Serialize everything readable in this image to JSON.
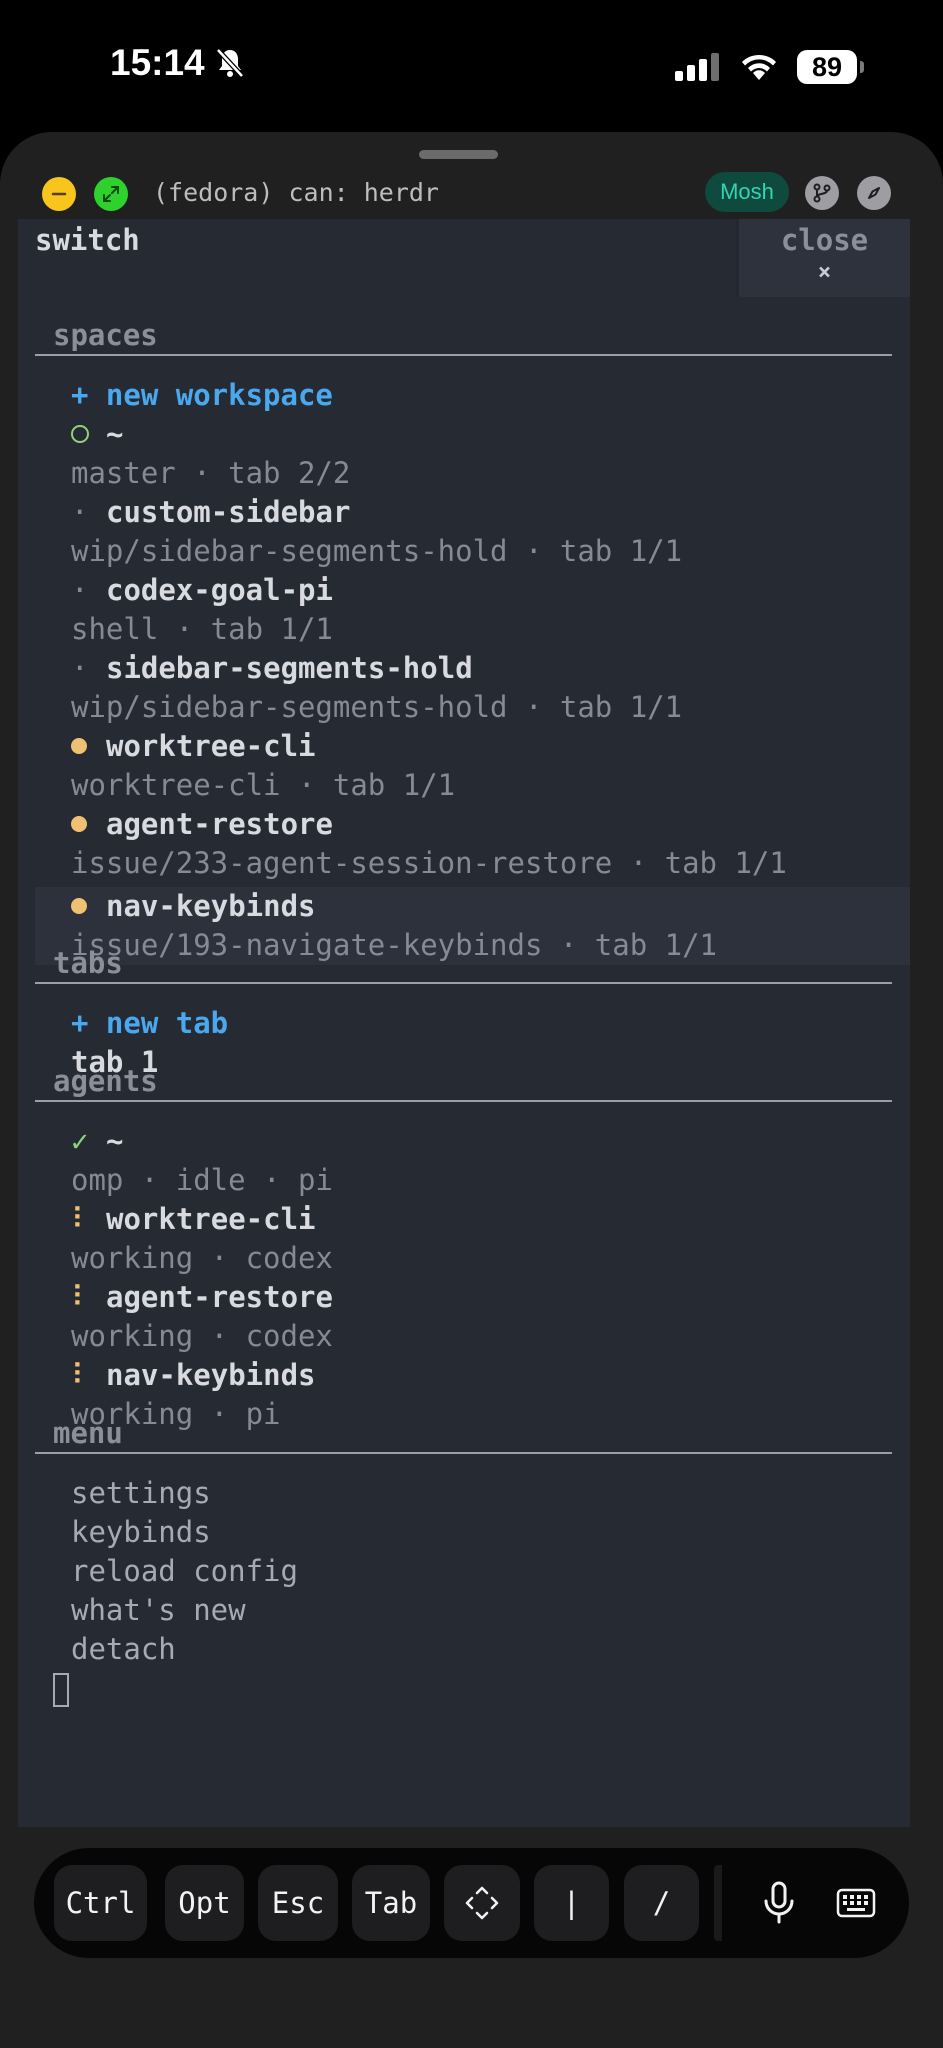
{
  "status_bar": {
    "time": "15:14",
    "battery": "89"
  },
  "header": {
    "title": "(fedora) can: herdr",
    "badge": "Mosh"
  },
  "terminal": {
    "title": "switch",
    "close_label": "close",
    "close_x": "×",
    "sections": {
      "spaces": "spaces",
      "tabs": "tabs",
      "agents": "agents",
      "menu": "menu"
    },
    "spaces": {
      "new_workspace": "+ new workspace",
      "items": [
        {
          "marker": "○",
          "name": "~",
          "detail": "master · tab 2/2"
        },
        {
          "marker": "·",
          "name": "custom-sidebar",
          "detail": "wip/sidebar-segments-hold · tab 1/1"
        },
        {
          "marker": "·",
          "name": "codex-goal-pi",
          "detail": "shell · tab 1/1"
        },
        {
          "marker": "·",
          "name": "sidebar-segments-hold",
          "detail": "wip/sidebar-segments-hold · tab 1/1"
        },
        {
          "marker": "●",
          "name": "worktree-cli",
          "detail": "worktree-cli · tab 1/1"
        },
        {
          "marker": "●",
          "name": "agent-restore",
          "detail": "issue/233-agent-session-restore · tab 1/1"
        },
        {
          "marker": "●",
          "name": "nav-keybinds",
          "detail": "issue/193-navigate-keybinds · tab 1/1"
        }
      ]
    },
    "tabs": {
      "new_tab": "+ new tab",
      "items": [
        "tab 1"
      ]
    },
    "agents": {
      "items": [
        {
          "marker": "✓",
          "name": "~",
          "detail": "omp · idle · pi"
        },
        {
          "marker": "⠇",
          "name": "worktree-cli",
          "detail": "working · codex"
        },
        {
          "marker": "⠇",
          "name": "agent-restore",
          "detail": "working · codex"
        },
        {
          "marker": "⠇",
          "name": "nav-keybinds",
          "detail": "working · pi"
        }
      ]
    },
    "menu": {
      "items": [
        "settings",
        "keybinds",
        "reload config",
        "what's new",
        "detach"
      ]
    }
  },
  "keys": {
    "ctrl": "Ctrl",
    "opt": "Opt",
    "esc": "Esc",
    "tab": "Tab",
    "pipe": "|",
    "slash": "/"
  },
  "colors": {
    "accent_blue": "#4aa8ef",
    "status_yellow": "#f0c073",
    "status_green": "#8fd27a",
    "mosh_green": "#33d4b0"
  }
}
